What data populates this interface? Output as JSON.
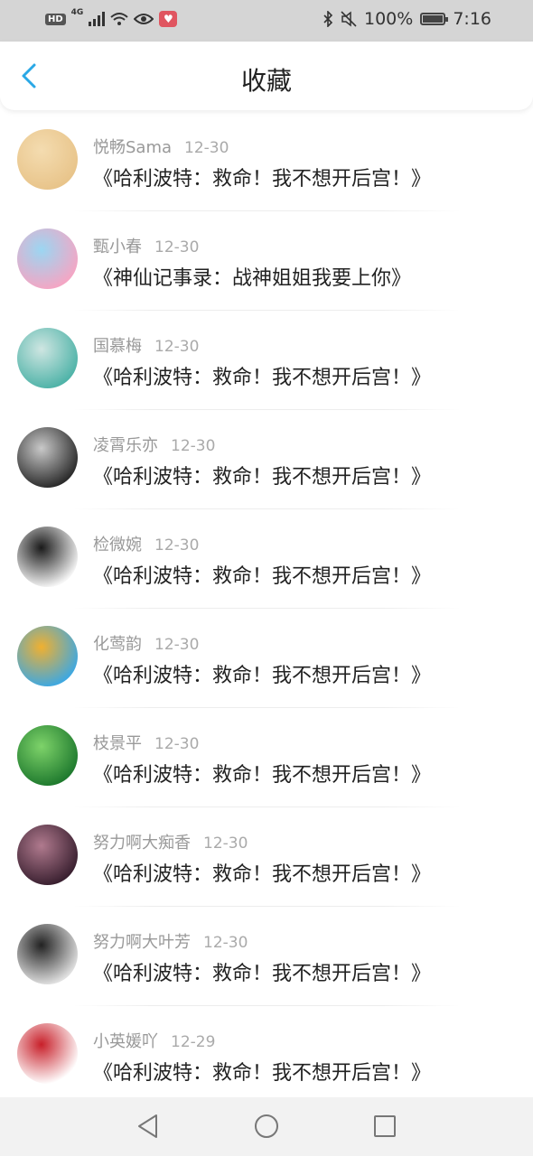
{
  "status_bar": {
    "hd": "HD",
    "network": "4G",
    "battery": "100%",
    "time": "7:16"
  },
  "header": {
    "title": "收藏",
    "back_icon": "chevron-left-icon"
  },
  "favorites": [
    {
      "user": "悦畅Sama",
      "date": "12-30",
      "title": "《哈利波特：救命！我不想开后宫！》",
      "avatar_colors": [
        "#e8c48a",
        "#f4dcb0"
      ]
    },
    {
      "user": "甄小春",
      "date": "12-30",
      "title": "《神仙记事录：战神姐姐我要上你》",
      "avatar_colors": [
        "#f4a6c4",
        "#9bd6f2"
      ]
    },
    {
      "user": "国慕梅",
      "date": "12-30",
      "title": "《哈利波特：救命！我不想开后宫！》",
      "avatar_colors": [
        "#4fb3a8",
        "#cfe6e2"
      ]
    },
    {
      "user": "凌霄乐亦",
      "date": "12-30",
      "title": "《哈利波特：救命！我不想开后宫！》",
      "avatar_colors": [
        "#2b2b2b",
        "#c9c9c9"
      ]
    },
    {
      "user": "检微婉",
      "date": "12-30",
      "title": "《哈利波特：救命！我不想开后宫！》",
      "avatar_colors": [
        "#f5f5f5",
        "#1a1a1a"
      ]
    },
    {
      "user": "化莺韵",
      "date": "12-30",
      "title": "《哈利波特：救命！我不想开后宫！》",
      "avatar_colors": [
        "#3fa8e0",
        "#f0b030"
      ]
    },
    {
      "user": "枝景平",
      "date": "12-30",
      "title": "《哈利波特：救命！我不想开后宫！》",
      "avatar_colors": [
        "#1f7a2e",
        "#7ed36a"
      ]
    },
    {
      "user": "努力啊大痴香",
      "date": "12-30",
      "title": "《哈利波特：救命！我不想开后宫！》",
      "avatar_colors": [
        "#3a2030",
        "#b07a8e"
      ]
    },
    {
      "user": "努力啊大叶芳",
      "date": "12-30",
      "title": "《哈利波特：救命！我不想开后宫！》",
      "avatar_colors": [
        "#e0e0e0",
        "#222222"
      ]
    },
    {
      "user": "小英媛吖",
      "date": "12-29",
      "title": "《哈利波特：救命！我不想开后宫！》",
      "avatar_colors": [
        "#ffffff",
        "#c8202a"
      ]
    }
  ],
  "nav_bar": {
    "back": "triangle-back-icon",
    "home": "circle-home-icon",
    "recents": "square-recents-icon"
  },
  "colors": {
    "accent": "#2aa8e6",
    "title_text": "#222222",
    "meta_text": "#999999",
    "status_bar_bg": "#d5d5d5",
    "nav_bar_bg": "#f2f2f2"
  }
}
